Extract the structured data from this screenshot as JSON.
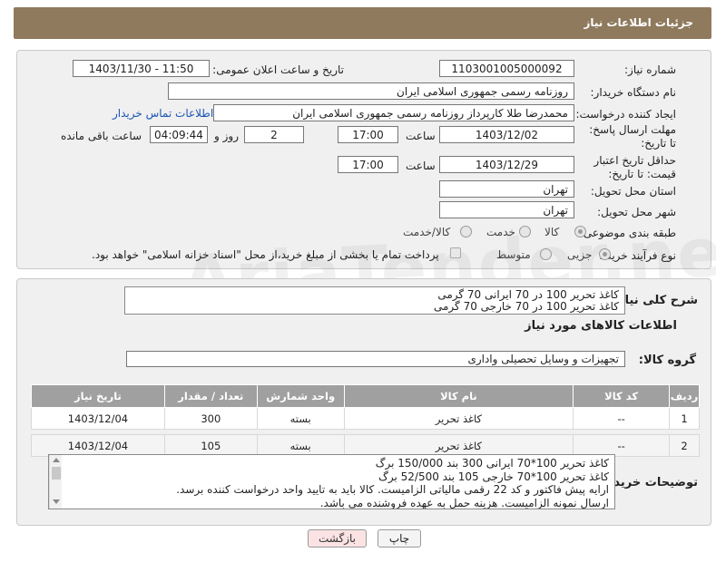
{
  "header": {
    "title": "جزئیات اطلاعات نیاز"
  },
  "form": {
    "need_number_label": "شماره نیاز:",
    "need_number": "1103001005000092",
    "announce_label": "تاریخ و ساعت اعلان عمومی:",
    "announce_value": "1403/11/30 - 11:50",
    "buyer_org_label": "نام دستگاه خریدار:",
    "buyer_org": "روزنامه رسمی جمهوری اسلامی ایران",
    "requester_label": "ایجاد کننده درخواست:",
    "requester": "محمدرضا طلا کارپرداز روزنامه رسمی جمهوری اسلامی ایران",
    "contact_link": "اطلاعات تماس خریدار",
    "deadline_label": "مهلت ارسال پاسخ: تا تاریخ:",
    "deadline_date": "1403/12/02",
    "time_label": "ساعت",
    "deadline_time": "17:00",
    "days_value": "2",
    "days_label": "روز و",
    "remaining_time": "04:09:44",
    "remaining_label": "ساعت باقی مانده",
    "validity_label": "حداقل تاریخ اعتبار قیمت: تا تاریخ:",
    "validity_date": "1403/12/29",
    "validity_time": "17:00",
    "province_label": "استان محل تحویل:",
    "province": "تهران",
    "city_label": "شهر محل تحویل:",
    "city": "تهران",
    "category_label": "طبقه بندی موضوعی:",
    "category_options": [
      "کالا",
      "خدمت",
      "کالا/خدمت"
    ],
    "process_label": "نوع فرآیند خرید :",
    "process_options": [
      "جزیی",
      "متوسط"
    ],
    "payment_note": "پرداخت تمام یا بخشی از مبلغ خرید،از محل \"اسناد خزانه اسلامی\" خواهد بود."
  },
  "watermark": "AriaTender.neT",
  "general": {
    "desc_label": "شرح کلی نیاز:",
    "desc_lines": [
      "کاغذ تحریر 100 در 70 ایرانی 70 گرمی",
      "کاغذ تحریر 100 در 70 خارجی  70 گرمی"
    ],
    "goods_info_title": "اطلاعات کالاهای مورد نیاز",
    "goods_group_label": "گروه کالا:",
    "goods_group": "تجهیزات و وسایل تحصیلی واداری"
  },
  "table": {
    "headers": [
      "ردیف",
      "کد کالا",
      "نام کالا",
      "واحد شمارش",
      "تعداد / مقدار",
      "تاریخ نیاز"
    ],
    "rows": [
      [
        "1",
        "--",
        "کاغذ تحریر",
        "بسته",
        "300",
        "1403/12/04"
      ],
      [
        "2",
        "--",
        "کاغذ تحریر",
        "بسته",
        "105",
        "1403/12/04"
      ]
    ]
  },
  "buyer_notes": {
    "label": "توضیحات خریدار:",
    "lines": [
      "کاغذ تحریر 100*70 ایرانی 300 بند 150/000 برگ",
      "کاغذ تحریر 100*70 خارجی 105 بند 52/500 برگ",
      "ارایه پیش فاکتور و کد 22 رقمی مالیاتی الزامیست. کالا باید به تایید واحد درخواست کننده برسد.",
      "ارسال نمونه الزامیست. هزینه حمل به عهده فروشنده می باشد."
    ]
  },
  "buttons": {
    "print": "چاپ",
    "back": "بازگشت"
  }
}
